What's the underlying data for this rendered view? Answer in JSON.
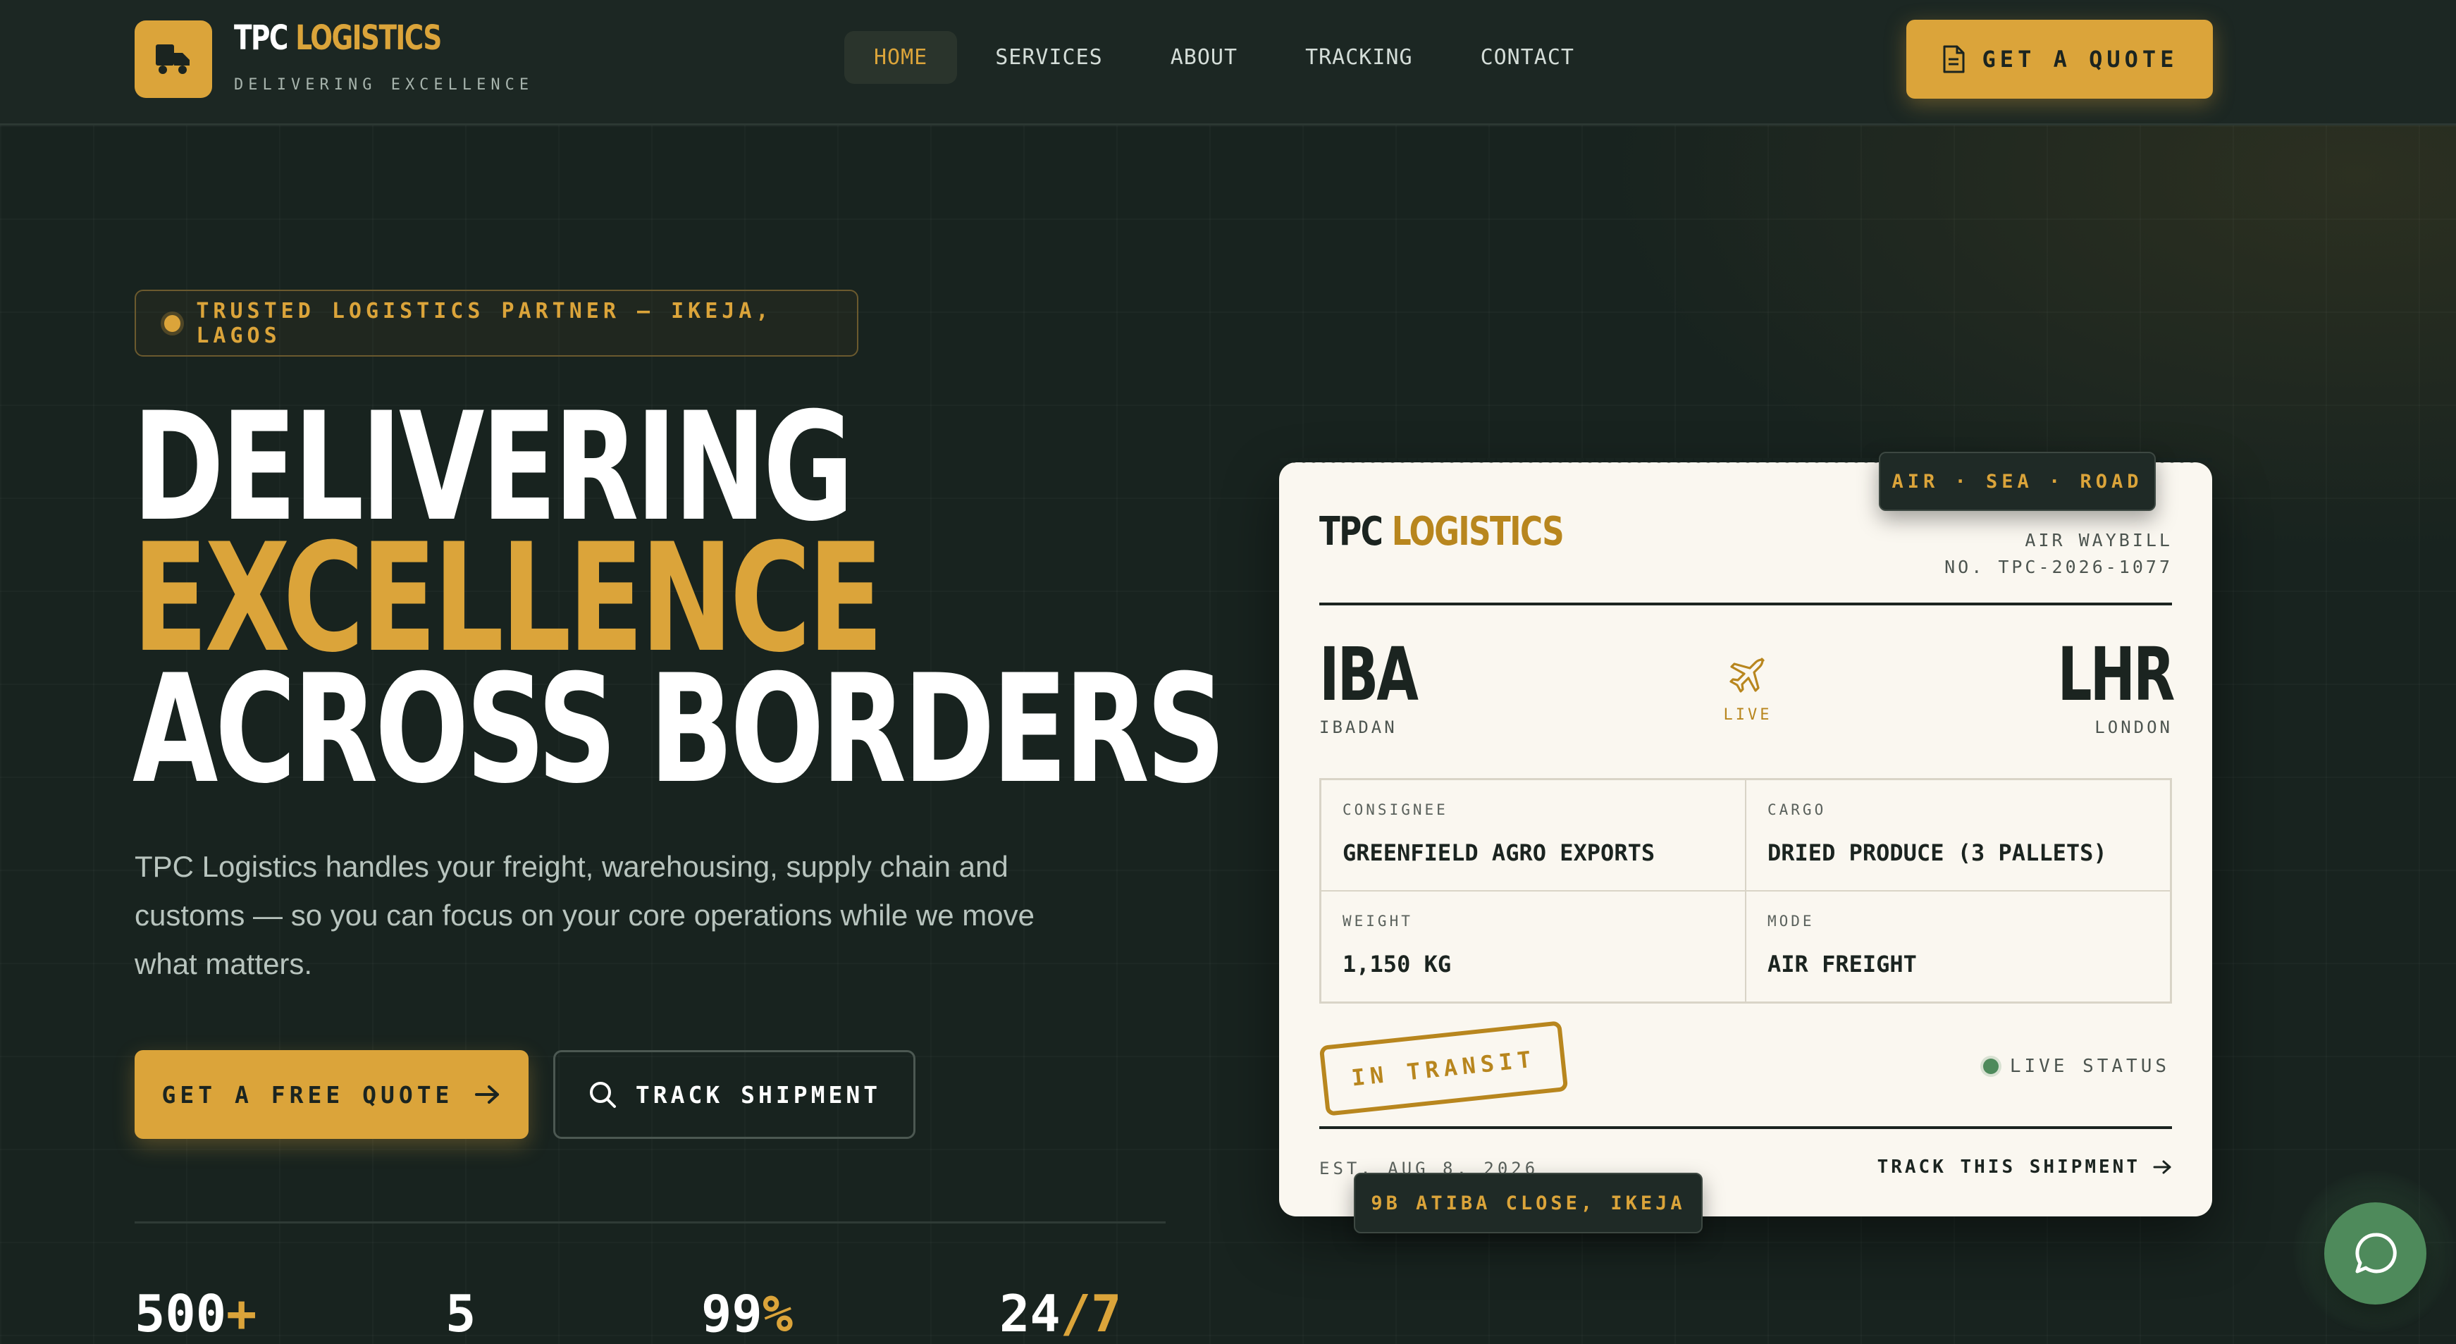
{
  "colors": {
    "accent": "#dba43a",
    "background": "#17221e",
    "card": "#faf7f0",
    "live": "#4e8a5b"
  },
  "brand": {
    "name_part1": "TPC",
    "name_part2": "LOGISTICS",
    "tagline": "DELIVERING EXCELLENCE",
    "logo_icon": "truck-icon"
  },
  "nav": {
    "items": [
      {
        "label": "HOME",
        "active": true
      },
      {
        "label": "SERVICES",
        "active": false
      },
      {
        "label": "ABOUT",
        "active": false
      },
      {
        "label": "TRACKING",
        "active": false
      },
      {
        "label": "CONTACT",
        "active": false
      }
    ],
    "quote_button": "GET A QUOTE",
    "quote_icon": "document-icon"
  },
  "hero": {
    "badge": "TRUSTED LOGISTICS PARTNER — IKEJA, LAGOS",
    "headline_line1": "DELIVERING",
    "headline_line2": "EXCELLENCE",
    "headline_line3": "ACROSS BORDERS",
    "subtext": "TPC Logistics handles your freight, warehousing, supply chain and customs — so you can focus on your core operations while we move what matters.",
    "primary_button": "GET A FREE QUOTE",
    "secondary_button": "TRACK SHIPMENT"
  },
  "stats": [
    {
      "value": "500",
      "suffix": "+"
    },
    {
      "value": "5",
      "suffix": ""
    },
    {
      "value": "99",
      "suffix": "%"
    },
    {
      "value": "24",
      "suffix": "/7"
    }
  ],
  "waybill": {
    "mode_tag": "AIR · SEA · ROAD",
    "brand_part1": "TPC",
    "brand_part2": "LOGISTICS",
    "awb_label": "AIR WAYBILL",
    "awb_number": "NO. TPC-2026-1077",
    "origin_code": "IBA",
    "origin_city": "IBADAN",
    "destination_code": "LHR",
    "destination_city": "LONDON",
    "live_label": "LIVE",
    "consignee_label": "CONSIGNEE",
    "consignee_value": "GREENFIELD AGRO EXPORTS",
    "cargo_label": "CARGO",
    "cargo_value": "DRIED PRODUCE (3 PALLETS)",
    "weight_label": "WEIGHT",
    "weight_value": "1,150 KG",
    "mode_label": "MODE",
    "mode_value": "AIR FREIGHT",
    "stamp": "IN TRANSIT",
    "live_status": "LIVE STATUS",
    "est": "EST. AUG 8, 2026",
    "track_link": "TRACK THIS SHIPMENT",
    "address_tag": "9B ATIBA CLOSE, IKEJA"
  },
  "chat": {
    "icon": "chat-icon"
  }
}
